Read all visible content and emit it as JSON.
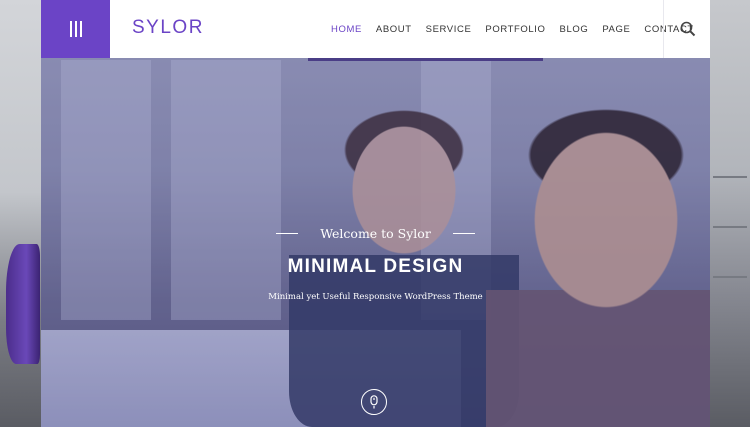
{
  "header": {
    "logo": "SYLOR",
    "nav": [
      {
        "label": "HOME",
        "active": true
      },
      {
        "label": "ABOUT",
        "active": false
      },
      {
        "label": "SERVICE",
        "active": false
      },
      {
        "label": "PORTFOLIO",
        "active": false
      },
      {
        "label": "BLOG",
        "active": false
      },
      {
        "label": "PAGE",
        "active": false
      },
      {
        "label": "CONTACT",
        "active": false
      }
    ],
    "menu_icon": "hamburger-vertical-icon",
    "search_icon": "search-icon"
  },
  "hero": {
    "welcome": "Welcome to Sylor",
    "headline": "MINIMAL DESIGN",
    "subline": "Minimal yet Useful Responsive WordPress Theme",
    "scroll_icon": "mouse-scroll-icon"
  },
  "colors": {
    "brand": "#6b44c6",
    "nav_text": "#333333",
    "white": "#ffffff"
  }
}
